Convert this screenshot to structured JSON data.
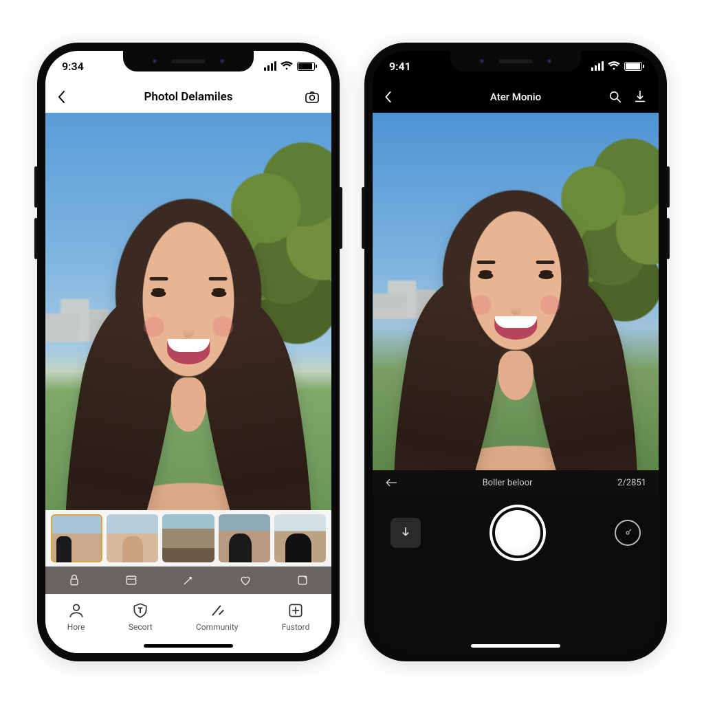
{
  "phone_left": {
    "status": {
      "time": "9:34"
    },
    "navbar": {
      "title": "Photol Delamiles"
    },
    "midbar_icons": [
      "lock-icon",
      "panel-icon",
      "wand-icon",
      "heart-icon",
      "share-icon"
    ],
    "tabs": [
      {
        "icon": "person-icon",
        "label": "Hore"
      },
      {
        "icon": "shield-icon",
        "label": "Secort"
      },
      {
        "icon": "pin-icon",
        "label": "Community"
      },
      {
        "icon": "plus-square-icon",
        "label": "Fustord"
      }
    ]
  },
  "phone_right": {
    "status": {
      "time": "9:41"
    },
    "navbar": {
      "title": "Ater Monio"
    },
    "subheader": {
      "label": "Boller beloor",
      "counter": "2/2851"
    }
  }
}
